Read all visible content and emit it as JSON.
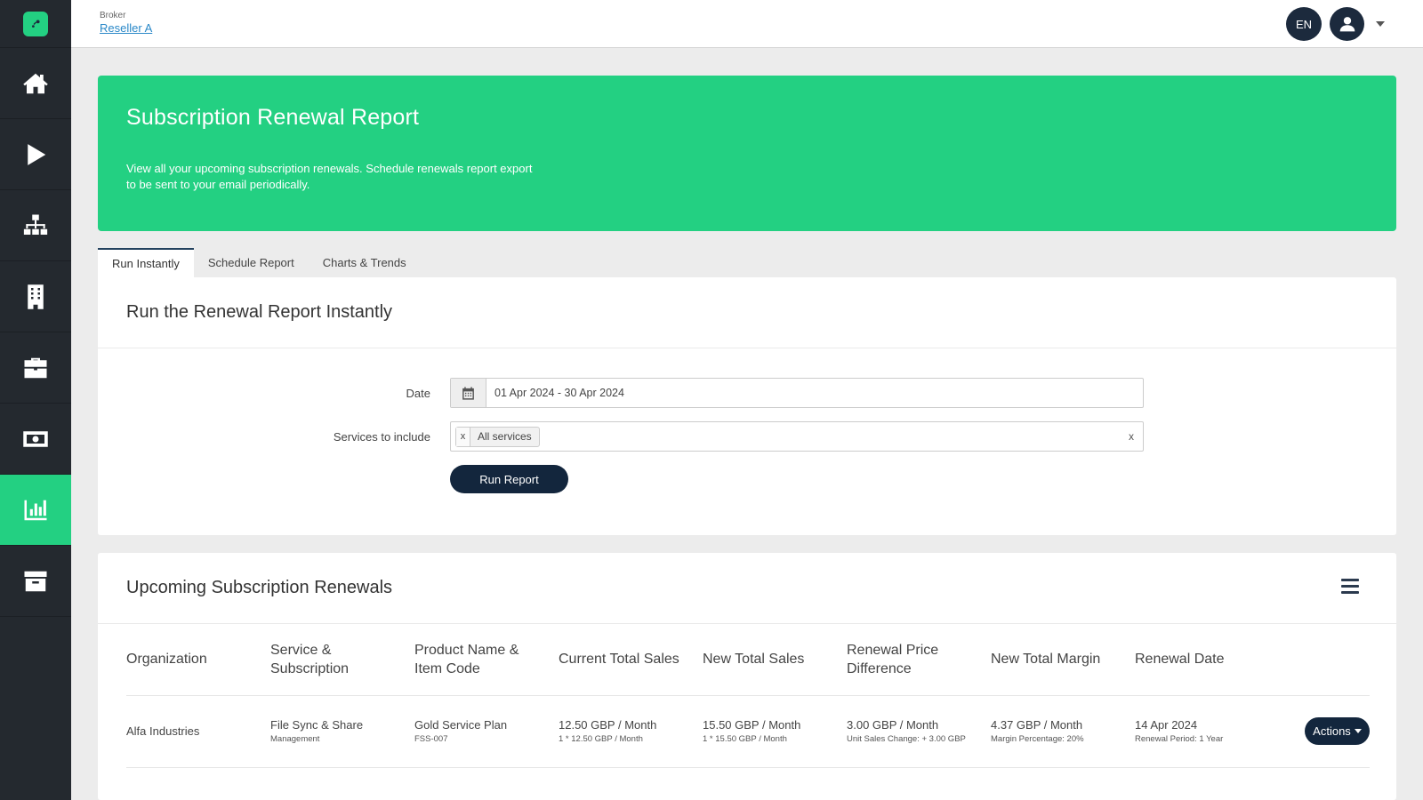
{
  "topbar": {
    "broker_label": "Broker",
    "broker_name": "Reseller A",
    "language": "EN"
  },
  "sidebar": {
    "items": [
      {
        "icon": "home-icon"
      },
      {
        "icon": "play-icon"
      },
      {
        "icon": "sitemap-icon"
      },
      {
        "icon": "building-icon"
      },
      {
        "icon": "briefcase-icon"
      },
      {
        "icon": "money-icon"
      },
      {
        "icon": "chart-icon",
        "active": true
      },
      {
        "icon": "archive-icon"
      }
    ],
    "accent_color": "#23d082"
  },
  "banner": {
    "title": "Subscription Renewal Report",
    "description": "View all your upcoming subscription renewals. Schedule renewals report export to be sent to your email periodically."
  },
  "tabs": [
    {
      "label": "Run Instantly",
      "active": true
    },
    {
      "label": "Schedule Report"
    },
    {
      "label": "Charts & Trends"
    }
  ],
  "run_card": {
    "title": "Run the Renewal Report Instantly",
    "date_label": "Date",
    "date_value": "01 Apr 2024 - 30 Apr 2024",
    "services_label": "Services to include",
    "service_chip": "All services",
    "chip_remove": "x",
    "clear_all": "x",
    "run_button": "Run Report"
  },
  "renewals_card": {
    "title": "Upcoming Subscription Renewals",
    "columns": [
      "Organization",
      "Service & Subscription",
      "Product Name & Item Code",
      "Current Total Sales",
      "New Total Sales",
      "Renewal Price Difference",
      "New Total Margin",
      "Renewal Date"
    ],
    "rows": [
      {
        "organization": "Alfa Industries",
        "service": "File Sync & Share",
        "service_sub": "Management",
        "product": "Gold Service Plan",
        "product_code": "FSS-007",
        "current_sales": "12.50 GBP / Month",
        "current_sales_sub": "1 * 12.50 GBP / Month",
        "new_sales": "15.50 GBP / Month",
        "new_sales_sub": "1 * 15.50 GBP / Month",
        "price_diff": "3.00 GBP / Month",
        "price_diff_sub": "Unit Sales Change: + 3.00 GBP",
        "margin": "4.37 GBP / Month",
        "margin_sub": "Margin Percentage: 20%",
        "renewal_date": "14 Apr 2024",
        "renewal_period": "Renewal Period: 1 Year",
        "actions_label": "Actions"
      }
    ]
  }
}
